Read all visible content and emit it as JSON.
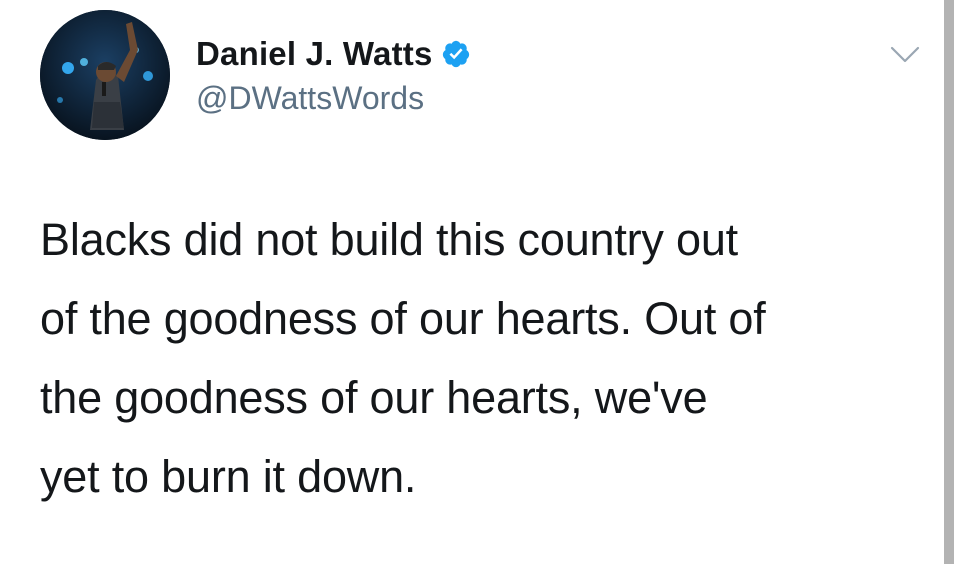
{
  "tweet": {
    "display_name": "Daniel J. Watts",
    "handle": "@DWattsWords",
    "text": "Blacks did not build this country out\nof the goodness of our hearts. Out of\nthe goodness of our hearts, we've\nyet to burn it down."
  },
  "icons": {
    "verified": "verified-badge-icon",
    "menu": "chevron-down-icon"
  },
  "colors": {
    "verified": "#1da1f2",
    "handle": "#5b7083",
    "text": "#14171a"
  }
}
